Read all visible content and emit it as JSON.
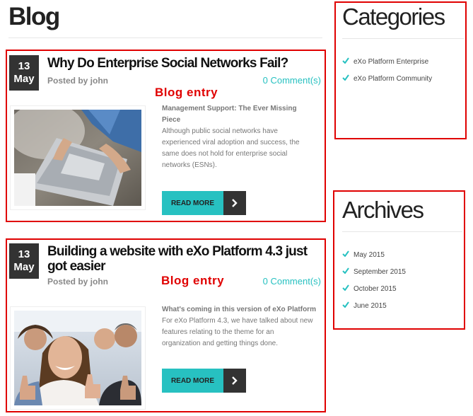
{
  "blog": {
    "title": "Blog"
  },
  "annotation_label": "Blog entry",
  "entries": [
    {
      "date_day": "13",
      "date_month": "May",
      "title": "Why Do Enterprise Social Networks Fail?",
      "posted_by": "Posted by john",
      "comments": "0 Comment(s)",
      "excerpt_heading": "Management Support: The Ever Missing Piece",
      "excerpt_body": "Although public social networks have experienced viral adoption and success, the same does not hold for enterprise social networks (ESNs).",
      "read_more": "READ MORE",
      "image": "laptop-photo"
    },
    {
      "date_day": "13",
      "date_month": "May",
      "title": "Building a website with eXo Platform 4.3 just got easier",
      "posted_by": "Posted by john",
      "comments": "0 Comment(s)",
      "excerpt_heading": "What's coming in this version of eXo Platform",
      "excerpt_body": "For eXo Platform 4.3, we have talked about new features relating to the theme for an organization and getting things done.",
      "read_more": "READ MORE",
      "image": "thumbs-up-team-photo"
    }
  ],
  "sidebar": {
    "categories": {
      "title": "Categories",
      "items": [
        "eXo Platform Enterprise",
        "eXo Platform Community"
      ]
    },
    "archives": {
      "title": "Archives",
      "items": [
        "May 2015",
        "September 2015",
        "October 2015",
        "June 2015"
      ]
    }
  },
  "colors": {
    "accent": "#27c1c1",
    "dark": "#333333",
    "annotation": "#e00000"
  }
}
